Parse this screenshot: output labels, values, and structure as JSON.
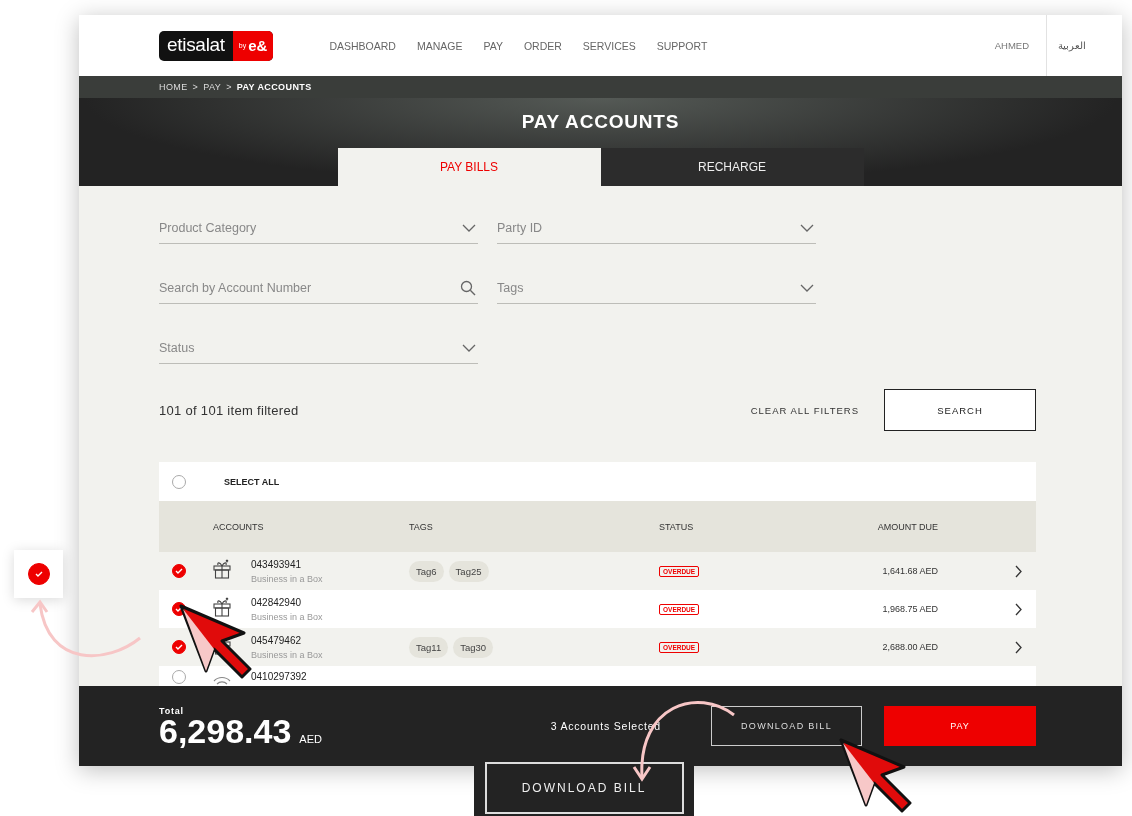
{
  "header": {
    "logo": {
      "text": "etisalat",
      "badge_top": "by",
      "badge": "e&"
    },
    "nav": [
      "DASHBOARD",
      "MANAGE",
      "PAY",
      "ORDER",
      "SERVICES",
      "SUPPORT"
    ],
    "user": "AHMED",
    "language": "العربية"
  },
  "breadcrumb": {
    "separator": ">",
    "items": [
      "HOME",
      "PAY",
      "PAY ACCOUNTS"
    ]
  },
  "page_title": "PAY ACCOUNTS",
  "tabs": [
    {
      "label": "PAY BILLS",
      "selected": true
    },
    {
      "label": "RECHARGE",
      "selected": false
    }
  ],
  "filters": [
    {
      "kind": "dropdown",
      "placeholder": "Product Category"
    },
    {
      "kind": "dropdown",
      "placeholder": "Party ID"
    },
    {
      "kind": "search",
      "placeholder": "Search by Account Number"
    },
    {
      "kind": "dropdown",
      "placeholder": "Tags"
    },
    {
      "kind": "dropdown",
      "placeholder": "Status"
    }
  ],
  "result_count": "101 of 101 item filtered",
  "clear_filters": "CLEAR ALL FILTERS",
  "search_button": "SEARCH",
  "table": {
    "select_all": {
      "label": "SELECT ALL",
      "checked": false
    },
    "columns": [
      "ACCOUNTS",
      "TAGS",
      "STATUS",
      "AMOUNT DUE"
    ],
    "rows": [
      {
        "selected": true,
        "kind": "box",
        "account": "043493941",
        "product": "Business in a Box",
        "tags": [
          "Tag6",
          "Tag25"
        ],
        "status": "OVERDUE",
        "amount": "1,641.68 AED"
      },
      {
        "selected": true,
        "kind": "box",
        "account": "042842940",
        "product": "Business in a Box",
        "tags": [],
        "status": "OVERDUE",
        "amount": "1,968.75 AED"
      },
      {
        "selected": true,
        "kind": "box",
        "account": "045479462",
        "product": "Business in a Box",
        "tags": [
          "Tag11",
          "Tag30"
        ],
        "status": "OVERDUE",
        "amount": "2,688.00 AED"
      },
      {
        "selected": false,
        "kind": "wifi",
        "account": "0410297392"
      }
    ]
  },
  "footer": {
    "total_label": "Total",
    "total": "6,298.43",
    "currency": "AED",
    "selected_count": "3 Accounts Selected",
    "download_button": "DOWNLOAD BILL",
    "pay_button": "PAY"
  },
  "callouts": {
    "checkbox": {
      "checked": true
    },
    "download_button": "DOWNLOAD BILL"
  }
}
